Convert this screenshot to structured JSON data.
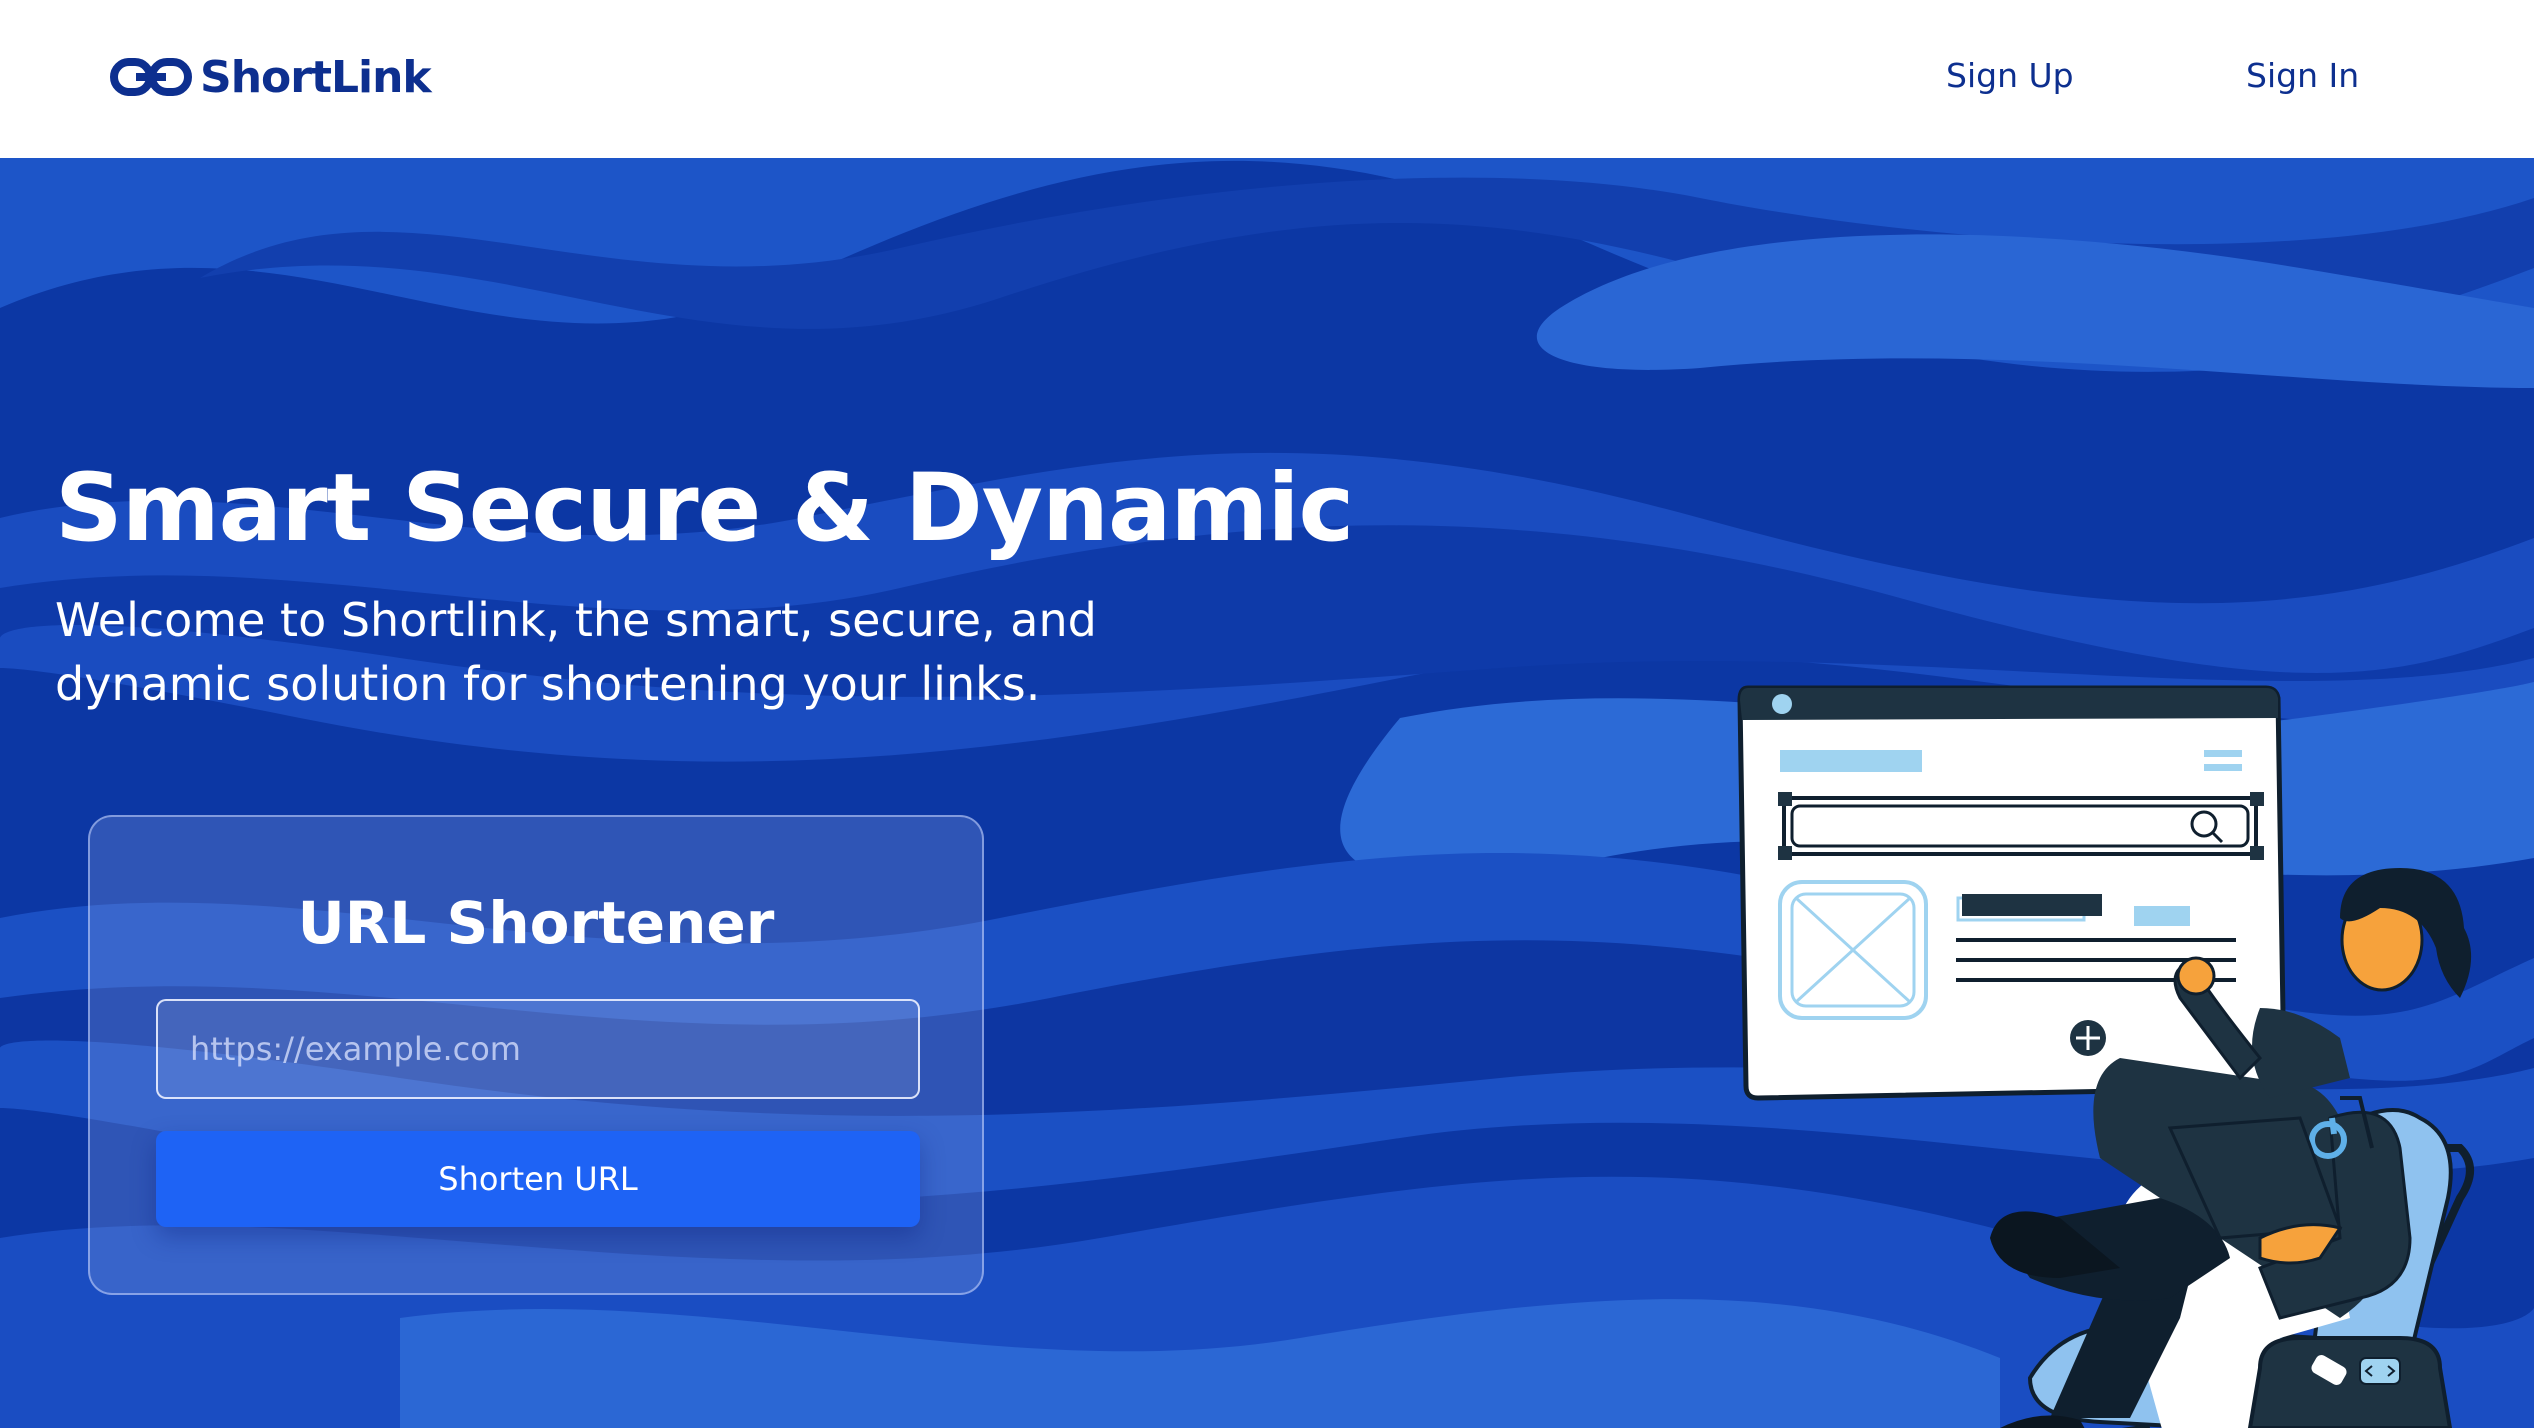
{
  "nav": {
    "brand": "ShortLink",
    "links": {
      "signup": "Sign Up",
      "signin": "Sign In"
    }
  },
  "hero": {
    "title": "Smart Secure & Dynamic",
    "subtitle": "Welcome to Shortlink, the smart, secure, and dynamic solution for shortening your links."
  },
  "shortener": {
    "title": "URL Shortener",
    "input_placeholder": "https://example.com",
    "input_value": "",
    "button_label": "Shorten URL"
  },
  "colors": {
    "brand": "#0d2f8f",
    "hero_bg": "#0c3aa8",
    "button": "#1e63f5"
  },
  "icons": [
    "link-logo-icon",
    "search-icon",
    "plus-icon",
    "image-placeholder-icon",
    "power-icon",
    "code-icon"
  ]
}
